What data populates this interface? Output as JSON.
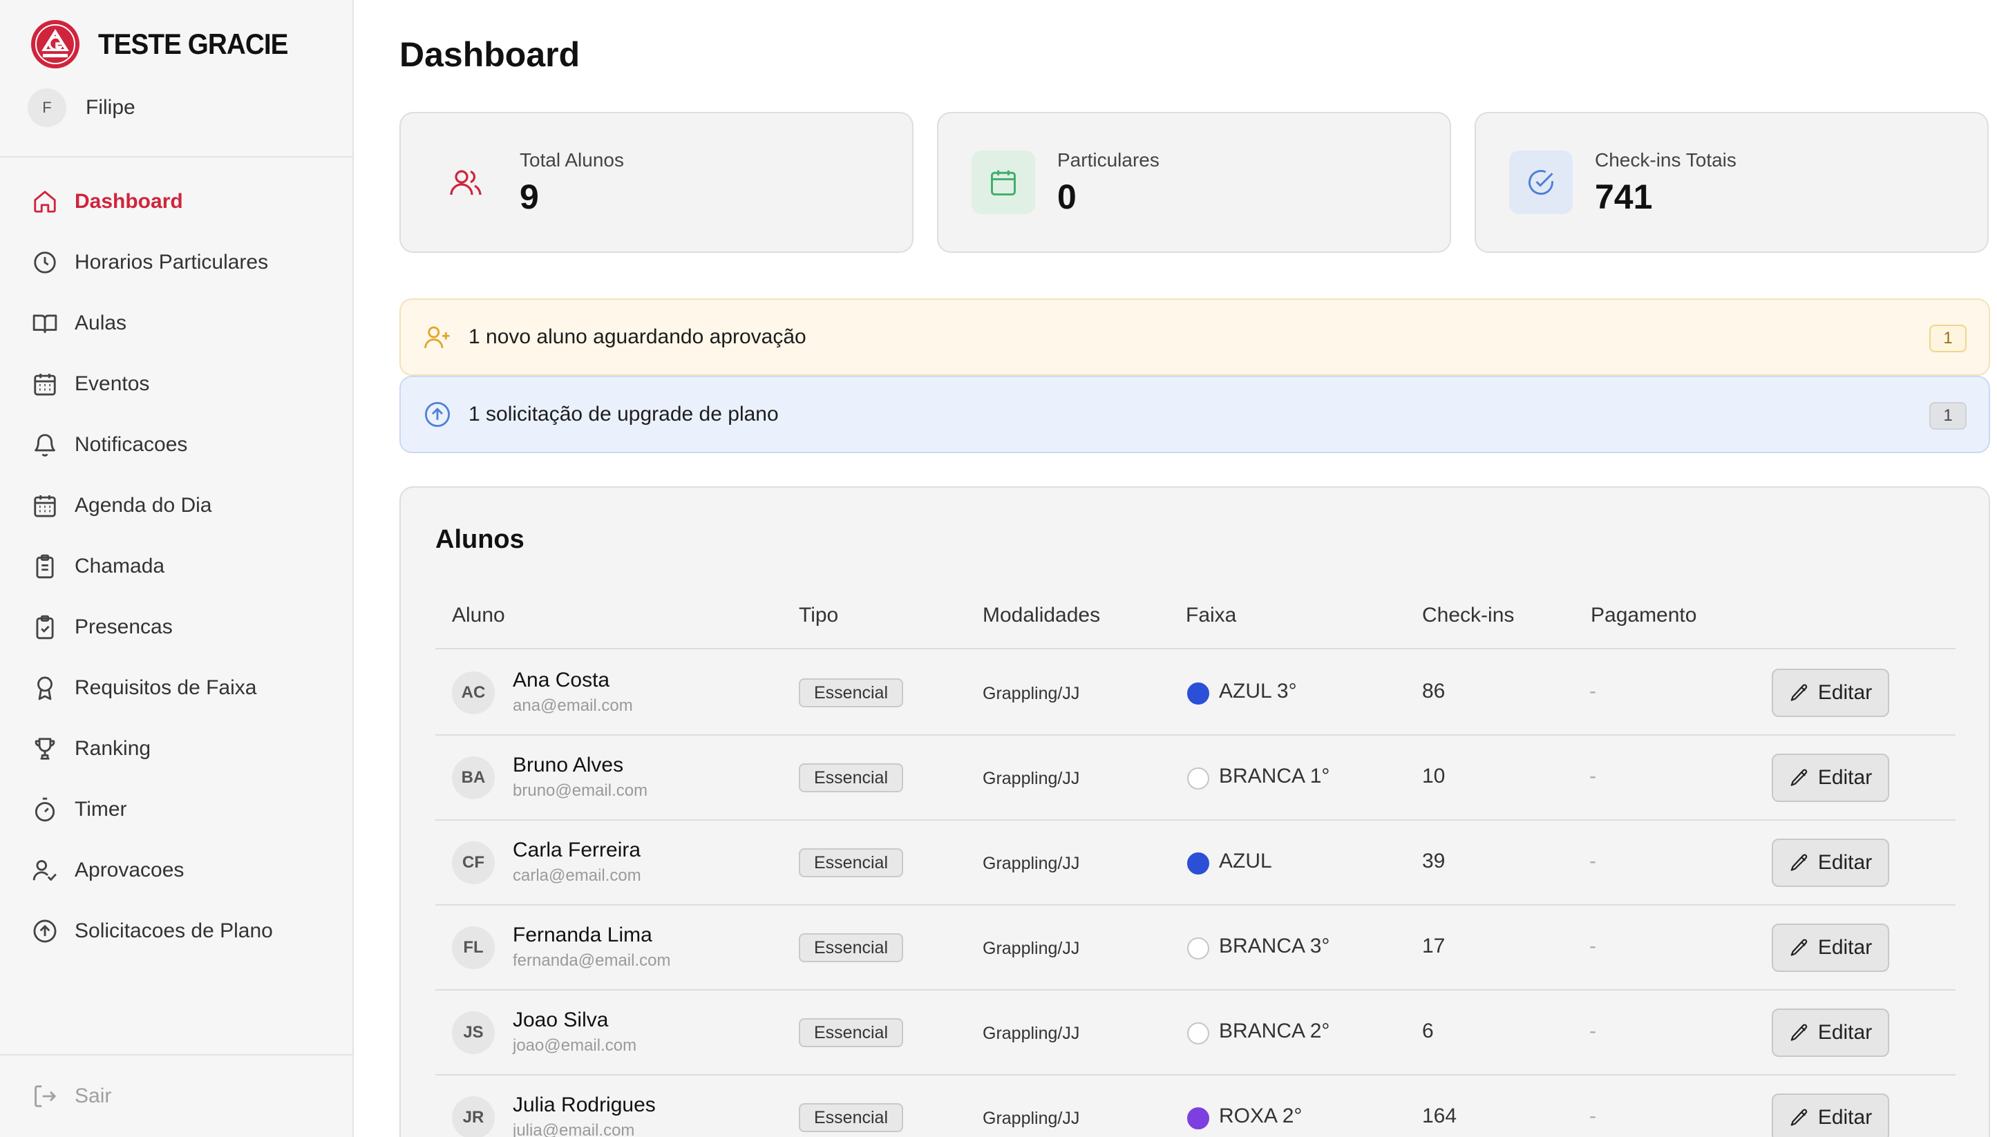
{
  "brand": {
    "name": "TESTE GRACIE",
    "logo_icon": "gracie-logo",
    "accent": "#d0243c"
  },
  "user": {
    "initial": "F",
    "name": "Filipe"
  },
  "sidebar": {
    "items": [
      {
        "label": "Dashboard",
        "icon": "home-icon",
        "active": true
      },
      {
        "label": "Horarios Particulares",
        "icon": "clock-icon"
      },
      {
        "label": "Aulas",
        "icon": "book-icon"
      },
      {
        "label": "Eventos",
        "icon": "calendar-icon"
      },
      {
        "label": "Notificacoes",
        "icon": "bell-icon"
      },
      {
        "label": "Agenda do Dia",
        "icon": "calendar-icon"
      },
      {
        "label": "Chamada",
        "icon": "clipboard-icon"
      },
      {
        "label": "Presencas",
        "icon": "clipboard-check-icon"
      },
      {
        "label": "Requisitos de Faixa",
        "icon": "award-icon"
      },
      {
        "label": "Ranking",
        "icon": "trophy-icon"
      },
      {
        "label": "Timer",
        "icon": "timer-icon"
      },
      {
        "label": "Aprovacoes",
        "icon": "user-check-icon"
      },
      {
        "label": "Solicitacoes de Plano",
        "icon": "arrow-up-circle-icon"
      }
    ],
    "logout_label": "Sair"
  },
  "main": {
    "title": "Dashboard",
    "stats": [
      {
        "label": "Total Alunos",
        "value": "9",
        "icon": "users-icon",
        "color": "#d0243c"
      },
      {
        "label": "Particulares",
        "value": "0",
        "icon": "calendar-icon",
        "color": "#3fae6a"
      },
      {
        "label": "Check-ins Totais",
        "value": "741",
        "icon": "check-circle-icon",
        "color": "#4d7fd6"
      }
    ],
    "alerts": [
      {
        "text": "1 novo aluno aguardando aprovação",
        "count": "1",
        "icon": "user-plus-icon",
        "color": "#e0a526"
      },
      {
        "text": "1 solicitação de upgrade de plano",
        "count": "1",
        "icon": "arrow-up-circle-icon",
        "color": "#4d7fd6"
      }
    ],
    "students": {
      "title": "Alunos",
      "columns": [
        "Aluno",
        "Tipo",
        "Modalidades",
        "Faixa",
        "Check-ins",
        "Pagamento"
      ],
      "edit_label": "Editar",
      "rows": [
        {
          "initials": "AC",
          "name": "Ana Costa",
          "email": "ana@email.com",
          "tipo": "Essencial",
          "modalidades": "Grappling/JJ",
          "faixa": "AZUL 3°",
          "belt_color": "#2b4fd6",
          "checkins": "86",
          "pagamento": "-"
        },
        {
          "initials": "BA",
          "name": "Bruno Alves",
          "email": "bruno@email.com",
          "tipo": "Essencial",
          "modalidades": "Grappling/JJ",
          "faixa": "BRANCA 1°",
          "belt_color": "#ffffff",
          "checkins": "10",
          "pagamento": "-"
        },
        {
          "initials": "CF",
          "name": "Carla Ferreira",
          "email": "carla@email.com",
          "tipo": "Essencial",
          "modalidades": "Grappling/JJ",
          "faixa": "AZUL",
          "belt_color": "#2b4fd6",
          "checkins": "39",
          "pagamento": "-"
        },
        {
          "initials": "FL",
          "name": "Fernanda Lima",
          "email": "fernanda@email.com",
          "tipo": "Essencial",
          "modalidades": "Grappling/JJ",
          "faixa": "BRANCA 3°",
          "belt_color": "#ffffff",
          "checkins": "17",
          "pagamento": "-"
        },
        {
          "initials": "JS",
          "name": "Joao Silva",
          "email": "joao@email.com",
          "tipo": "Essencial",
          "modalidades": "Grappling/JJ",
          "faixa": "BRANCA 2°",
          "belt_color": "#ffffff",
          "checkins": "6",
          "pagamento": "-"
        },
        {
          "initials": "JR",
          "name": "Julia Rodrigues",
          "email": "julia@email.com",
          "tipo": "Essencial",
          "modalidades": "Grappling/JJ",
          "faixa": "ROXA 2°",
          "belt_color": "#7d3fe0",
          "checkins": "164",
          "pagamento": "-"
        }
      ]
    }
  }
}
